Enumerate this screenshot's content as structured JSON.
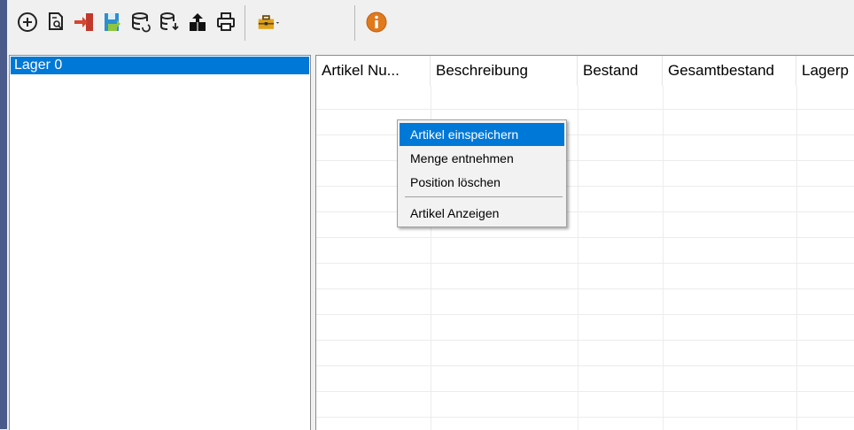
{
  "toolbar": {
    "buttons": [
      "add-icon",
      "search-document-icon",
      "import-icon",
      "save-icon",
      "database-refresh-icon",
      "database-download-icon",
      "package-icon",
      "print-icon",
      "toolbox-dropdown-icon",
      "info-icon"
    ]
  },
  "tree": {
    "items": [
      {
        "label": "Lager 0",
        "selected": true
      }
    ]
  },
  "grid": {
    "columns": [
      "Artikel Nu...",
      "Beschreibung",
      "Bestand",
      "Gesamtbestand",
      "Lagerp"
    ]
  },
  "context_menu": {
    "items": [
      "Artikel einspeichern",
      "Menge entnehmen",
      "Position löschen",
      "Artikel Anzeigen"
    ],
    "highlighted": "Artikel einspeichern"
  },
  "colors": {
    "selection": "#0078d7",
    "left_strip": "#4a5a8a",
    "info_orange": "#e07a1c"
  }
}
